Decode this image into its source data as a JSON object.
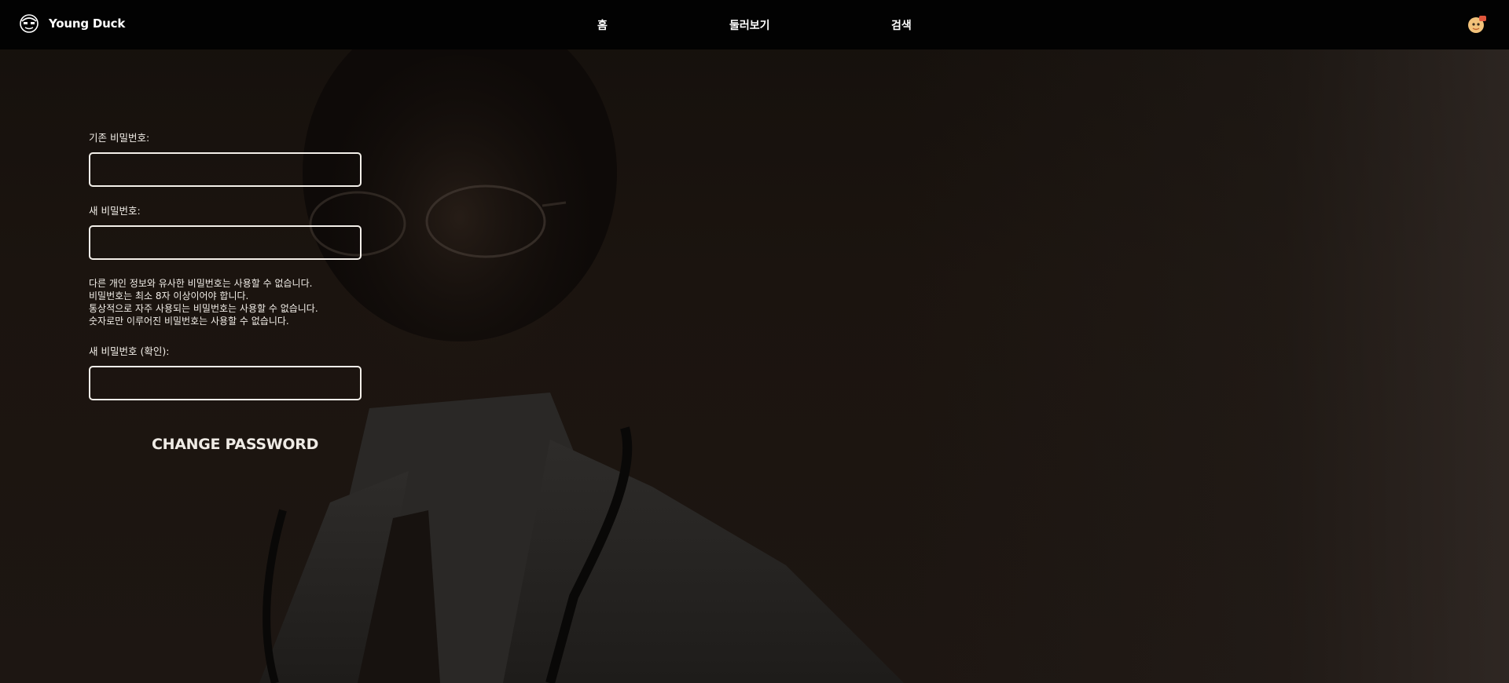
{
  "nav": {
    "brand": "Young Duck",
    "links": [
      "홈",
      "둘러보기",
      "검색"
    ]
  },
  "form": {
    "current_password_label": "기존 비밀번호:",
    "new_password_label": "새 비밀번호:",
    "help": [
      "다른 개인 정보와 유사한 비밀번호는 사용할 수 없습니다.",
      "비밀번호는 최소 8자 이상이어야 합니다.",
      "통상적으로 자주 사용되는 비밀번호는 사용할 수 없습니다.",
      "숫자로만 이루어진 비밀번호는 사용할 수 없습니다."
    ],
    "confirm_password_label": "새 비밀번호 (확인):",
    "submit_label": "CHANGE PASSWORD"
  },
  "colors": {
    "nav_background": "#020202",
    "text": "#f2eee8",
    "field_border": "#f4f0ea"
  }
}
